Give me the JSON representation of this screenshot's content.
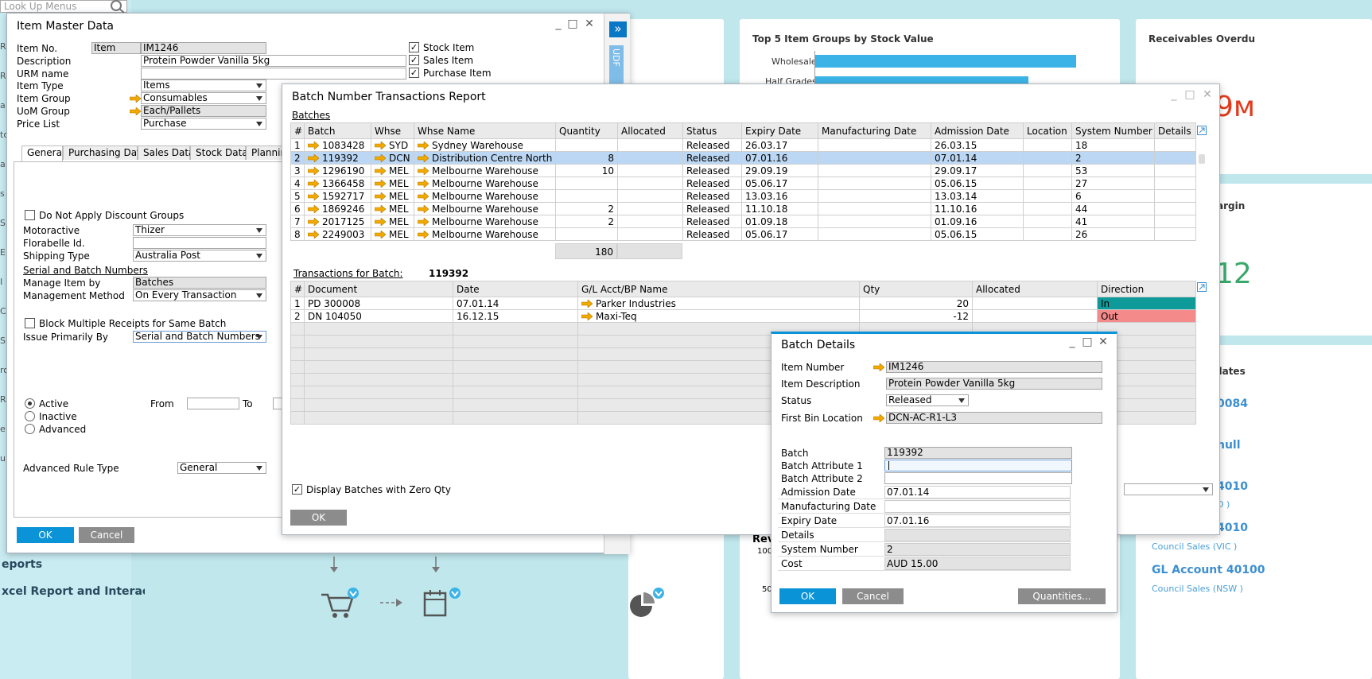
{
  "background": {
    "lookup_menus": "Look Up Menus",
    "chart1_title": "Top 5 Item Groups by Stock Value",
    "chart1_categories": [
      "Wholesale",
      "Half Grades"
    ],
    "receivables_title": "Receivables Overdu",
    "big_number_1": "9м",
    "margin_label": "argin",
    "big_number_2": "12",
    "updates_label": "dates",
    "link1": "0084",
    "link2": "null",
    "link3": "4010",
    "link3_sub": "D )",
    "link4": "4010",
    "link4_sub": "Council Sales (VIC )",
    "link5": "GL Account 40100",
    "link5_sub": "Council Sales (NSW )",
    "reports": "eports",
    "excel_report": "xcel Report and Interacti",
    "rev_label": "Rev",
    "axis_100": "100",
    "axis_50": "50",
    "left_letters": [
      "R",
      "R",
      "a",
      "to",
      "a",
      "s",
      "S",
      "E",
      "I",
      "C",
      "S",
      "ro",
      "R",
      "e",
      "u"
    ]
  },
  "item_master": {
    "title": "Item Master Data",
    "item_no_label": "Item No.",
    "item_no_type": "Item",
    "item_no": "IM1246",
    "description_label": "Description",
    "description": "Protein Powder Vanilla 5kg",
    "urm_label": "URM name",
    "urm_value": "",
    "item_type_label": "Item Type",
    "item_type": "Items",
    "item_group_label": "Item Group",
    "item_group": "Consumables",
    "uom_group_label": "UoM Group",
    "uom_group": "Each/Pallets",
    "price_list_label": "Price List",
    "price_list": "Purchase",
    "stock_item": "Stock Item",
    "sales_item": "Sales Item",
    "purchase_item": "Purchase Item",
    "tabs": [
      "General",
      "Purchasing Data",
      "Sales Data",
      "Stock Data",
      "Planning"
    ],
    "no_discount": "Do Not Apply Discount Groups",
    "motoractive_label": "Motoractive",
    "motoractive": "Thizer",
    "florabelle_label": "Florabelle Id.",
    "florabelle": "",
    "shipping_label": "Shipping Type",
    "shipping": "Australia Post",
    "serial_batch_link": "Serial and Batch Numbers",
    "manage_by_label": "Manage Item by",
    "manage_by": "Batches",
    "mgmt_method_label": "Management Method",
    "mgmt_method": "On Every Transaction",
    "block_multi": "Block Multiple Receipts for Same Batch",
    "issue_by_label": "Issue Primarily By",
    "issue_by": "Serial and Batch Numbers",
    "active": "Active",
    "inactive": "Inactive",
    "advanced": "Advanced",
    "from_label": "From",
    "to_label": "To",
    "adv_rule_label": "Advanced Rule Type",
    "adv_rule": "General",
    "ok": "OK",
    "cancel": "Cancel",
    "side_expand": "»",
    "udf": "UDF"
  },
  "batch_report": {
    "title": "Batch Number Transactions Report",
    "batches_label": "Batches",
    "columns": [
      "#",
      "Batch",
      "Whse",
      "Whse Name",
      "Quantity",
      "Allocated",
      "Status",
      "Expiry Date",
      "Manufacturing Date",
      "Admission Date",
      "Location",
      "System Number",
      "Details"
    ],
    "rows": [
      {
        "n": "1",
        "batch": "1083428",
        "whse": "SYD",
        "name": "Sydney Warehouse",
        "qty": "",
        "status": "Released",
        "expiry": "26.03.17",
        "admission": "26.03.15",
        "sysno": "18"
      },
      {
        "n": "2",
        "batch": "119392",
        "whse": "DCN",
        "name": "Distribution Centre North",
        "qty": "8",
        "status": "Released",
        "expiry": "07.01.16",
        "admission": "07.01.14",
        "sysno": "2"
      },
      {
        "n": "3",
        "batch": "1296190",
        "whse": "MEL",
        "name": "Melbourne Warehouse",
        "qty": "10",
        "status": "Released",
        "expiry": "29.09.19",
        "admission": "29.09.17",
        "sysno": "53"
      },
      {
        "n": "4",
        "batch": "1366458",
        "whse": "MEL",
        "name": "Melbourne Warehouse",
        "qty": "",
        "status": "Released",
        "expiry": "05.06.17",
        "admission": "05.06.15",
        "sysno": "27"
      },
      {
        "n": "5",
        "batch": "1592717",
        "whse": "MEL",
        "name": "Melbourne Warehouse",
        "qty": "",
        "status": "Released",
        "expiry": "13.03.16",
        "admission": "13.03.14",
        "sysno": "6"
      },
      {
        "n": "6",
        "batch": "1869246",
        "whse": "MEL",
        "name": "Melbourne Warehouse",
        "qty": "2",
        "status": "Released",
        "expiry": "11.10.18",
        "admission": "11.10.16",
        "sysno": "44"
      },
      {
        "n": "7",
        "batch": "2017125",
        "whse": "MEL",
        "name": "Melbourne Warehouse",
        "qty": "2",
        "status": "Released",
        "expiry": "01.09.18",
        "admission": "01.09.16",
        "sysno": "41"
      },
      {
        "n": "8",
        "batch": "2249003",
        "whse": "MEL",
        "name": "Melbourne Warehouse",
        "qty": "",
        "status": "Released",
        "expiry": "05.06.17",
        "admission": "05.06.15",
        "sysno": "26"
      }
    ],
    "total_qty": "180",
    "tx_label": "Transactions for Batch:",
    "tx_batch": "119392",
    "tx_columns": [
      "#",
      "Document",
      "Date",
      "G/L Acct/BP Name",
      "Qty",
      "Allocated",
      "Direction"
    ],
    "tx_rows": [
      {
        "n": "1",
        "doc": "PD 300008",
        "date": "07.01.14",
        "bp": "Parker Industries",
        "qty": "20",
        "dir": "In"
      },
      {
        "n": "2",
        "doc": "DN 104050",
        "date": "16.12.15",
        "bp": "Maxi-Teq",
        "qty": "-12",
        "dir": "Out"
      }
    ],
    "display_zero": "Display Batches with Zero Qty",
    "ok": "OK",
    "colors": {
      "in": "#0f9a9a",
      "out": "#f58a8a"
    }
  },
  "batch_details": {
    "title": "Batch Details",
    "item_number_label": "Item Number",
    "item_number": "IM1246",
    "item_desc_label": "Item Description",
    "item_desc": "Protein Powder Vanilla 5kg",
    "status_label": "Status",
    "status": "Released",
    "first_bin_label": "First Bin Location",
    "first_bin": "DCN-AC-R1-L3",
    "batch_label": "Batch",
    "batch": "119392",
    "attr1_label": "Batch Attribute 1",
    "attr1": "",
    "attr2_label": "Batch Attribute 2",
    "attr2": "",
    "admission_label": "Admission Date",
    "admission": "07.01.14",
    "mfg_label": "Manufacturing Date",
    "mfg": "",
    "expiry_label": "Expiry Date",
    "expiry": "07.01.16",
    "details_label": "Details",
    "details": "",
    "sysno_label": "System Number",
    "sysno": "2",
    "cost_label": "Cost",
    "cost": "AUD 15.00",
    "ok": "OK",
    "cancel": "Cancel",
    "quantities": "Quantities..."
  }
}
